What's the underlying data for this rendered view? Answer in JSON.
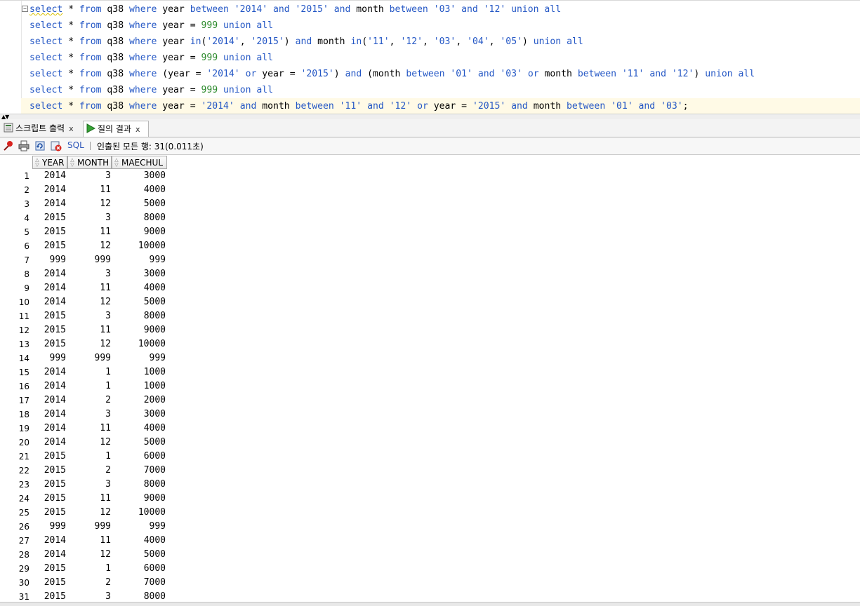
{
  "editor": {
    "lines": [
      "select * from q38 where year between '2014' and '2015' and month between '03' and '12' union all",
      "select * from q38 where year = 999 union all",
      "select * from q38 where year in('2014', '2015') and month in('11', '12', '03', '04', '05') union all",
      "select * from q38 where year = 999 union all",
      "select * from q38 where (year = '2014' or year = '2015') and (month between '01' and '03' or month between '11' and '12') union all",
      "select * from q38 where year = 999 union all",
      "select * from q38 where year = '2014' and month between '11' and '12' or year = '2015' and month between '01' and '03';"
    ],
    "fold_symbol": "−"
  },
  "tabs": [
    {
      "label": "스크립트 출력",
      "close": "x",
      "icon": "script-output-icon"
    },
    {
      "label": "질의 결과",
      "close": "x",
      "icon": "run-query-icon"
    }
  ],
  "toolbar": {
    "sql_label": "SQL",
    "separator": "|",
    "status": "인출된 모든 행: 31(0.011초)"
  },
  "grid": {
    "columns": [
      "YEAR",
      "MONTH",
      "MAECHUL"
    ],
    "rows": [
      [
        2014,
        3,
        3000
      ],
      [
        2014,
        11,
        4000
      ],
      [
        2014,
        12,
        5000
      ],
      [
        2015,
        3,
        8000
      ],
      [
        2015,
        11,
        9000
      ],
      [
        2015,
        12,
        10000
      ],
      [
        999,
        999,
        999
      ],
      [
        2014,
        3,
        3000
      ],
      [
        2014,
        11,
        4000
      ],
      [
        2014,
        12,
        5000
      ],
      [
        2015,
        3,
        8000
      ],
      [
        2015,
        11,
        9000
      ],
      [
        2015,
        12,
        10000
      ],
      [
        999,
        999,
        999
      ],
      [
        2014,
        1,
        1000
      ],
      [
        2014,
        1,
        1000
      ],
      [
        2014,
        2,
        2000
      ],
      [
        2014,
        3,
        3000
      ],
      [
        2014,
        11,
        4000
      ],
      [
        2014,
        12,
        5000
      ],
      [
        2015,
        1,
        6000
      ],
      [
        2015,
        2,
        7000
      ],
      [
        2015,
        3,
        8000
      ],
      [
        2015,
        11,
        9000
      ],
      [
        2015,
        12,
        10000
      ],
      [
        999,
        999,
        999
      ],
      [
        2014,
        11,
        4000
      ],
      [
        2014,
        12,
        5000
      ],
      [
        2015,
        1,
        6000
      ],
      [
        2015,
        2,
        7000
      ],
      [
        2015,
        3,
        8000
      ]
    ]
  },
  "colors": {
    "keyword": "#2457c5",
    "number": "#2c8a2c",
    "current_line": "#fffae6",
    "link": "#2b54b8"
  }
}
